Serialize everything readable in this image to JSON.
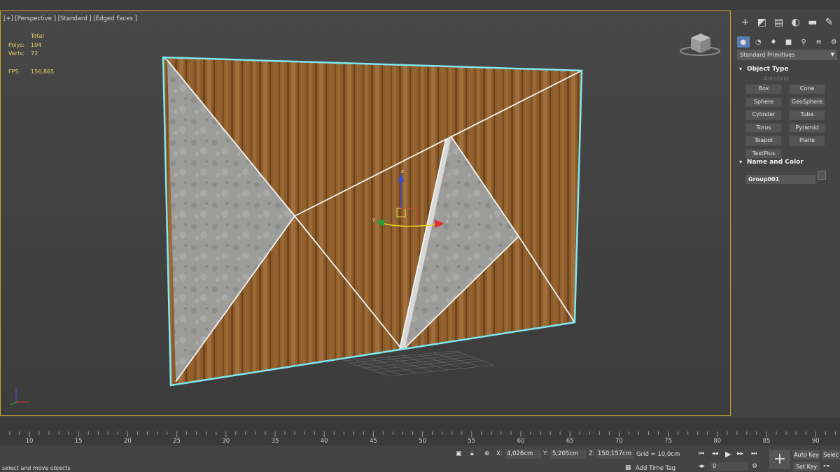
{
  "viewport": {
    "label": "[+] [Perspective ] [Standard ] [Edged Faces ]",
    "stats": {
      "header": "Total",
      "rows": [
        {
          "key": "Polys:",
          "value": "104"
        },
        {
          "key": "Verts:",
          "value": "72"
        },
        {
          "key": "FPS:",
          "value": "156,865"
        }
      ]
    },
    "gizmo_axes": {
      "x": "x",
      "y": "y",
      "z": "z"
    }
  },
  "command_panel": {
    "tabs": [
      "create-icon",
      "modify-icon",
      "hierarchy-icon",
      "motion-icon",
      "display-icon",
      "utilities-icon"
    ],
    "subtabs": [
      "geometry-icon",
      "shapes-icon",
      "lights-icon",
      "cameras-icon",
      "helpers-icon",
      "spacewarps-icon",
      "systems-icon"
    ],
    "category": "Standard Primitives",
    "object_type": {
      "title": "Object Type",
      "autogrid": "AutoGrid",
      "buttons": [
        "Box",
        "Cone",
        "Sphere",
        "GeoSphere",
        "Cylinder",
        "Tube",
        "Torus",
        "Pyramid",
        "Teapot",
        "Plane",
        "TextPlus"
      ]
    },
    "name_color": {
      "title": "Name and Color",
      "name": "Group001"
    }
  },
  "timeline": {
    "ticks": [
      "10",
      "15",
      "20",
      "25",
      "30",
      "35",
      "40",
      "45",
      "50",
      "55",
      "60",
      "65",
      "70",
      "75",
      "80",
      "85",
      "90"
    ]
  },
  "status": {
    "prompt": "select and move objects",
    "x_label": "X:",
    "x_value": "4,026cm",
    "y_label": "Y:",
    "y_value": "5,205cm",
    "z_label": "Z:",
    "z_value": "150,157cm",
    "grid": "Grid = 10,0cm",
    "add_time_tag": "Add Time Tag",
    "auto_key": "Auto Key",
    "set_key": "Set Key",
    "selected": "Selec",
    "frame": "0"
  },
  "colors": {
    "viewport_border": "#c8a42a",
    "selection": "#7fe8f0",
    "stats_text": "#e6d36a",
    "wood": "#8a5a2a",
    "concrete": "#9a9a98"
  }
}
